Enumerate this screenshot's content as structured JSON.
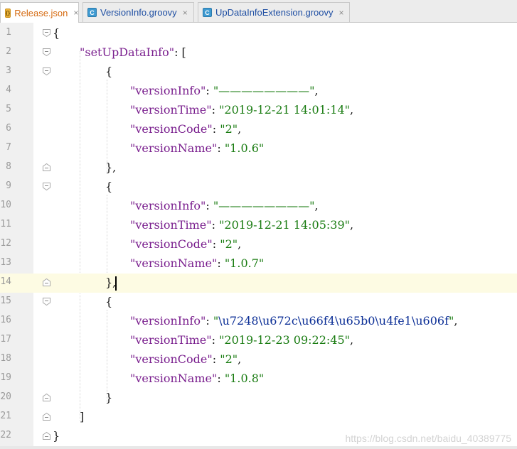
{
  "tabs": [
    {
      "label": "Release.json",
      "kind": "json",
      "active": true
    },
    {
      "label": "VersionInfo.groovy",
      "kind": "groovy",
      "active": false
    },
    {
      "label": "UpDataInfoExtension.groovy",
      "kind": "groovy",
      "active": false
    }
  ],
  "tab_close_glyph": "×",
  "file_icon_letters": {
    "json": "{}",
    "groovy": "C"
  },
  "line_numbers": [
    "1",
    "2",
    "3",
    "4",
    "5",
    "6",
    "7",
    "8",
    "9",
    "10",
    "11",
    "12",
    "13",
    "14",
    "15",
    "16",
    "17",
    "18",
    "19",
    "20",
    "21",
    "22"
  ],
  "current_line": "14",
  "code": {
    "l1": "{",
    "l2_key": "\"setUpDataInfo\"",
    "l2_rest": ": [",
    "l3": "{",
    "l4_key": "\"versionInfo\"",
    "l4_val": "\"————————\"",
    "l5_key": "\"versionTime\"",
    "l5_val": "\"2019-12-21 14:01:14\"",
    "l6_key": "\"versionCode\"",
    "l6_val": "\"2\"",
    "l7_key": "\"versionName\"",
    "l7_val": "\"1.0.6\"",
    "l8": "},",
    "l9": "{",
    "l10_key": "\"versionInfo\"",
    "l10_val": "\"————————\"",
    "l11_key": "\"versionTime\"",
    "l11_val": "\"2019-12-21 14:05:39\"",
    "l12_key": "\"versionCode\"",
    "l12_val": "\"2\"",
    "l13_key": "\"versionName\"",
    "l13_val": "\"1.0.7\"",
    "l14": "},",
    "l15": "{",
    "l16_key": "\"versionInfo\"",
    "l16_q": "\"",
    "l16_esc": "\\u7248\\u672c\\u66f4\\u65b0\\u4fe1\\u606f",
    "l17_key": "\"versionTime\"",
    "l17_val": "\"2019-12-23 09:22:45\"",
    "l18_key": "\"versionCode\"",
    "l18_val": "\"2\"",
    "l19_key": "\"versionName\"",
    "l19_val": "\"1.0.8\"",
    "l20": "}",
    "l21": "]",
    "l22": "}",
    "colon": ": ",
    "comma": ",",
    "quote": "\""
  },
  "watermark": "https://blog.csdn.net/baidu_40389775",
  "colors": {
    "key": "#7a1f8e",
    "string": "#1a7c12",
    "escape": "#0b2e96",
    "current_line_bg": "#fdfbe3",
    "gutter_bg": "#f0f0f0"
  }
}
